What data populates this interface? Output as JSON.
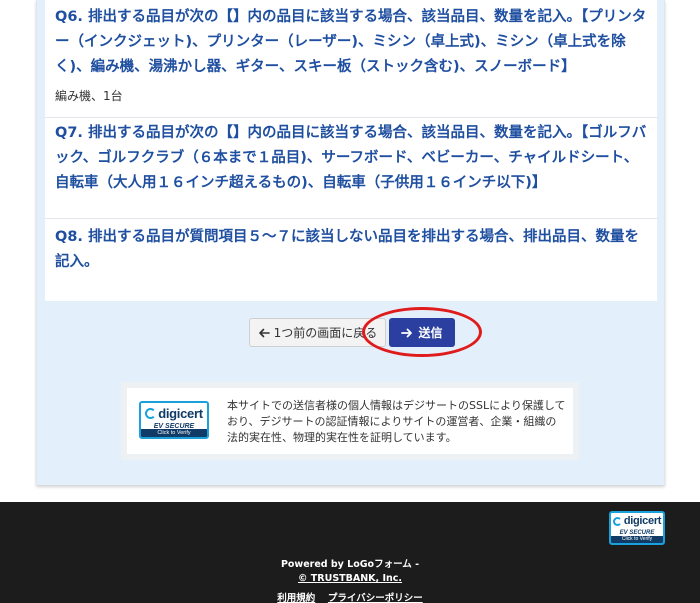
{
  "questions": [
    {
      "label": "Q6. 排出する品目が次の【】内の品目に該当する場合、該当品目、数量を記入。【プリンター（インクジェット)、プリンター（レーザー)、ミシン（卓上式)、ミシン（卓上式を除く)、編み機、湯沸かし器、ギター、スキー板（ストック含む)、スノーボード】",
      "answer": "編み機、1台"
    },
    {
      "label": "Q7. 排出する品目が次の【】内の品目に該当する場合、該当品目、数量を記入。【ゴルフバック、ゴルフクラブ（６本まで１品目)、サーフボード、ベビーカー、チャイルドシート、自転車（大人用１６インチ超えるもの)、自転車（子供用１６インチ以下)】",
      "answer": ""
    },
    {
      "label": "Q8. 排出する品目が質問項目５～７に該当しない品目を排出する場合、排出品目、数量を記入。",
      "answer": ""
    }
  ],
  "buttons": {
    "back_label": "1つ前の画面に戻る",
    "back_icon": "arrow-left-icon",
    "submit_label": "送信",
    "submit_icon": "arrow-right-icon"
  },
  "ssl": {
    "seal_brand": "digicert",
    "seal_badge": "EV SECURE",
    "seal_verify": "Click to Verify",
    "text": "本サイトでの送信者様の個人情報はデジサートのSSLにより保護しており、デジサートの認証情報によりサイトの運営者、企業・組織の法的実在性、物理的実在性を証明しています。"
  },
  "footer": {
    "powered_by": "Powered by LoGoフォーム -",
    "company": "© TRUSTBANK, Inc.",
    "terms": "利用規約",
    "privacy": "プライバシーポリシー"
  },
  "colors": {
    "question_text": "#1f4fa0",
    "submit_button": "#2a3fa0",
    "highlight": "#e01b1b",
    "card_bg": "#e3f0fb",
    "footer_bg": "#1c1c1c",
    "seal_accent": "#1aa1dc"
  }
}
